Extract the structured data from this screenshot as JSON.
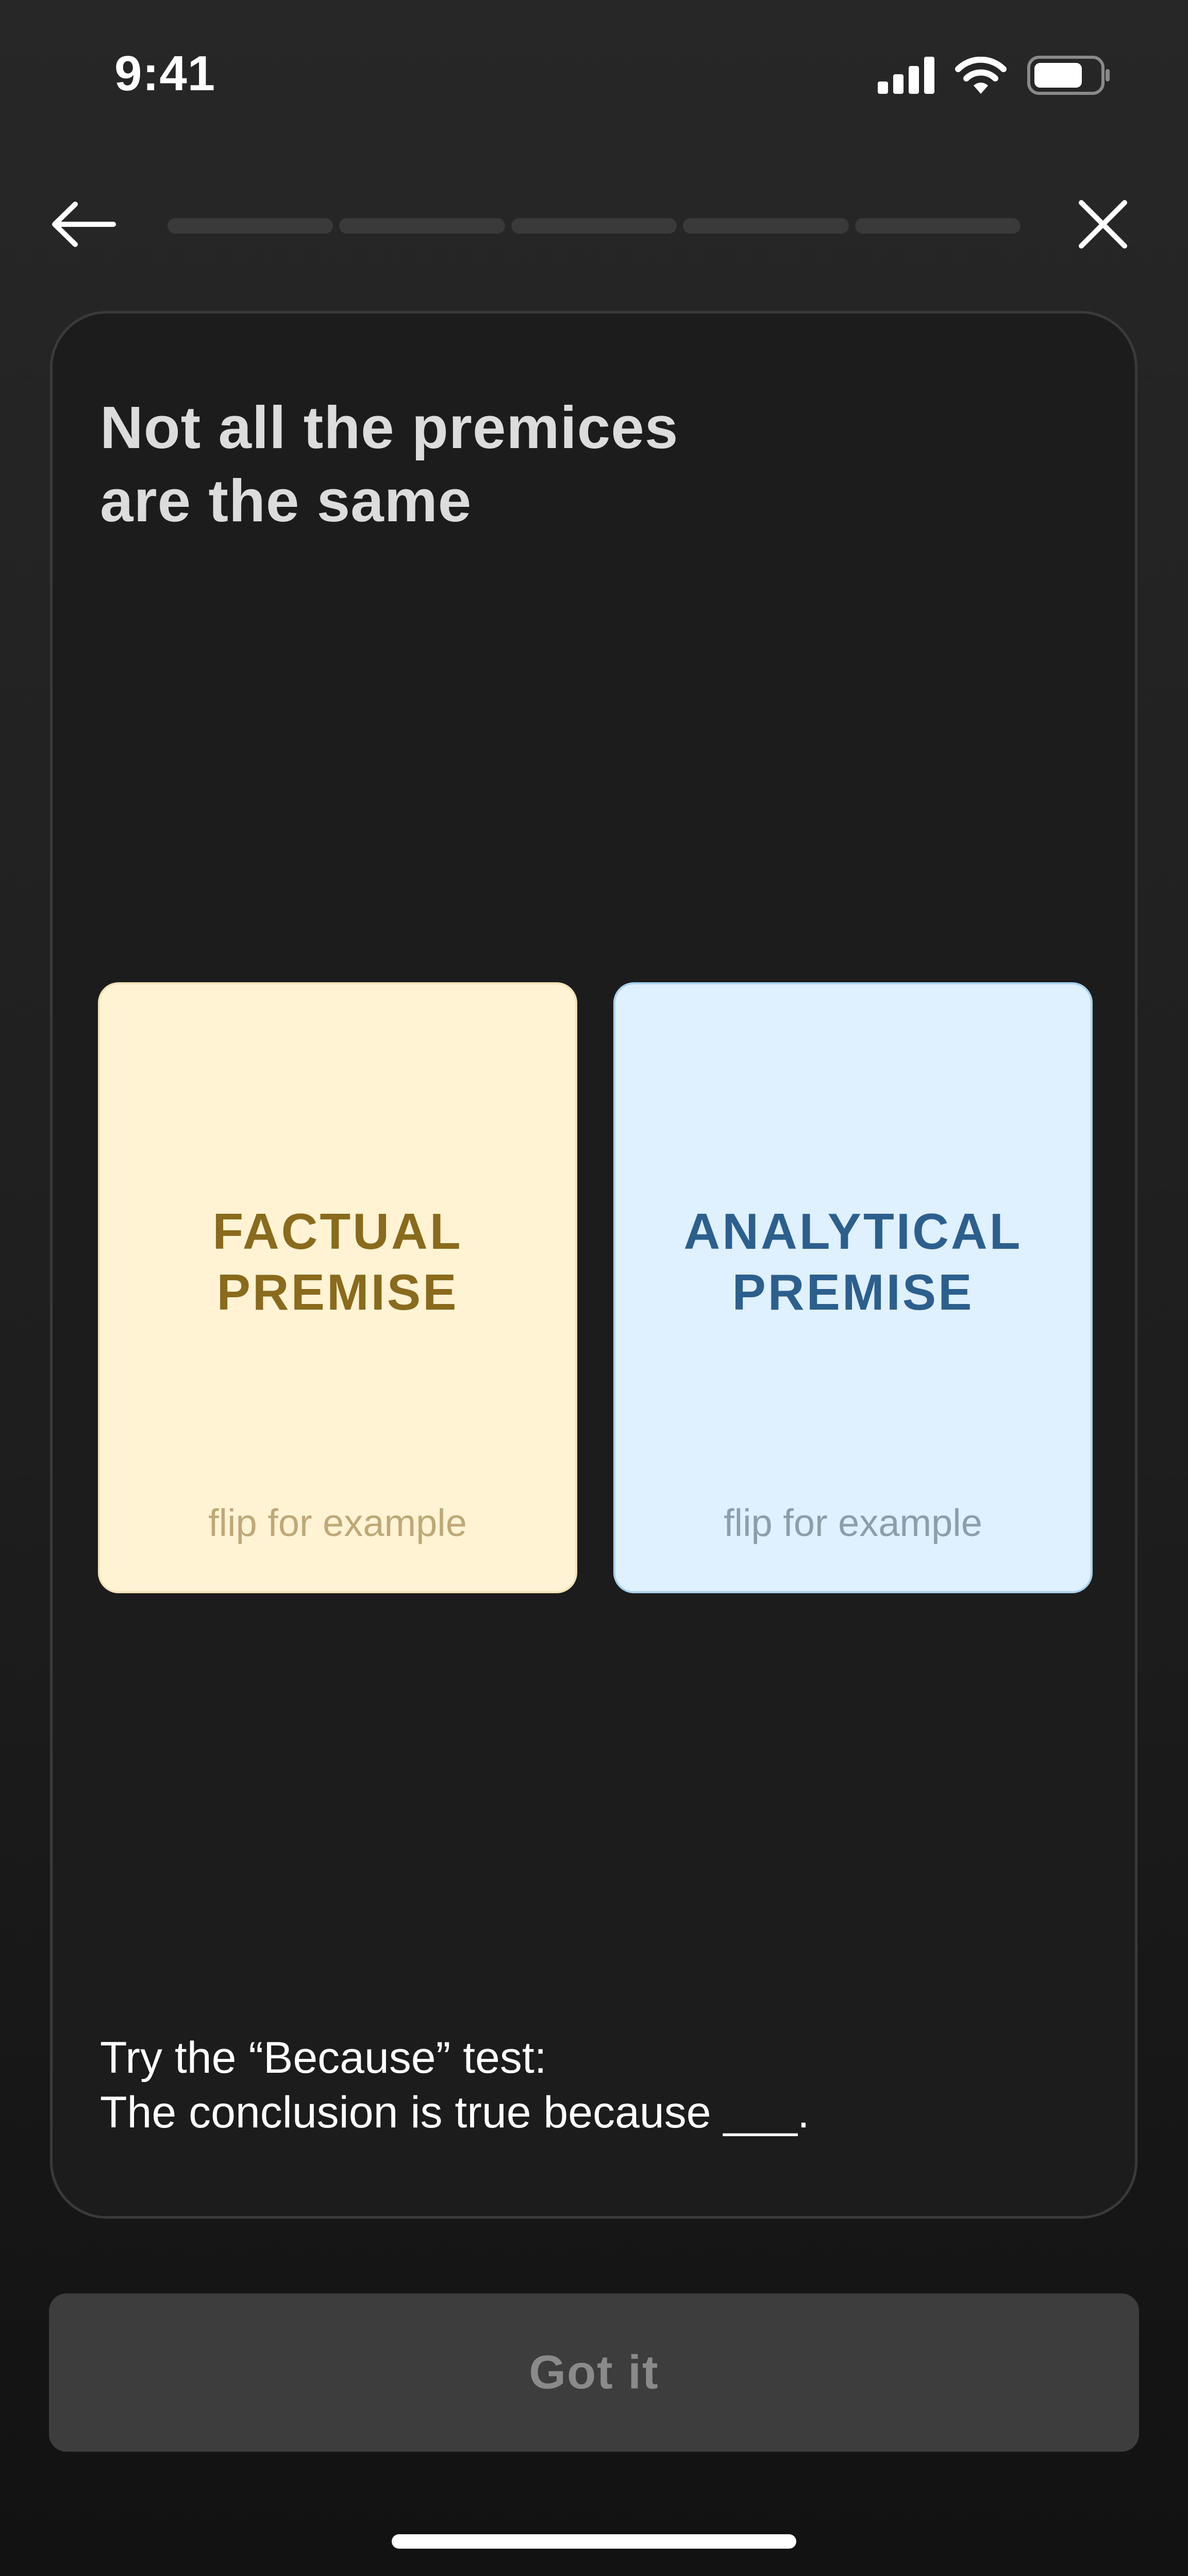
{
  "status_bar": {
    "time": "9:41",
    "icons": [
      "signal-icon",
      "wifi-icon",
      "battery-icon"
    ]
  },
  "nav": {
    "back_icon": "arrow-left-icon",
    "close_icon": "close-icon",
    "progress": {
      "total_steps": 5,
      "completed_steps": 0
    }
  },
  "card": {
    "title_line1": "Not all the premices",
    "title_line2": "are the same",
    "factual": {
      "label_line1": "FACTUAL",
      "label_line2": "PREMISE",
      "hint": "flip for example"
    },
    "analytical": {
      "label_line1": "ANALYTICAL",
      "label_line2": "PREMISE",
      "hint": "flip for example"
    },
    "test_line1": "Try the “Because” test:",
    "test_line2": "The conclusion is true because ___."
  },
  "footer": {
    "button_label": "Got it"
  },
  "colors": {
    "background": "#1f1f1f",
    "factual_bg": "#fff3d4",
    "factual_text": "#8a6a1c",
    "analytical_bg": "#dff0ff",
    "analytical_text": "#2c5f8d",
    "button_bg": "#3d3d3d",
    "button_text": "#8a8a8a"
  }
}
